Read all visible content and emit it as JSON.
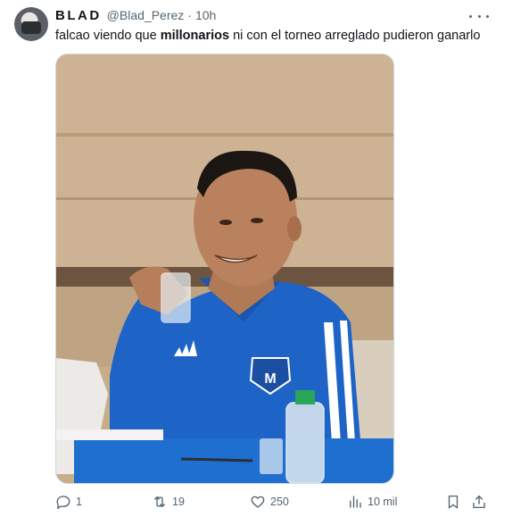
{
  "author": {
    "display_name": "BLAD",
    "handle": "@Blad_Perez",
    "separator": "·",
    "time": "10h"
  },
  "tweet": {
    "text_before": "falcao viendo que ",
    "text_bold": "millonarios",
    "text_after": " ni con el torneo arreglado pudieron ganarlo"
  },
  "media": {
    "badge_letter": "M"
  },
  "actions": {
    "replies": "1",
    "retweets": "19",
    "likes": "250",
    "views": "10 mil"
  },
  "icons": [
    "more-icon",
    "reply-icon",
    "retweet-icon",
    "like-icon",
    "views-icon",
    "bookmark-icon",
    "share-icon"
  ],
  "colors": {
    "text": "#0f1419",
    "muted": "#536471",
    "border": "#cfd9de",
    "jersey": "#1e63c6"
  }
}
